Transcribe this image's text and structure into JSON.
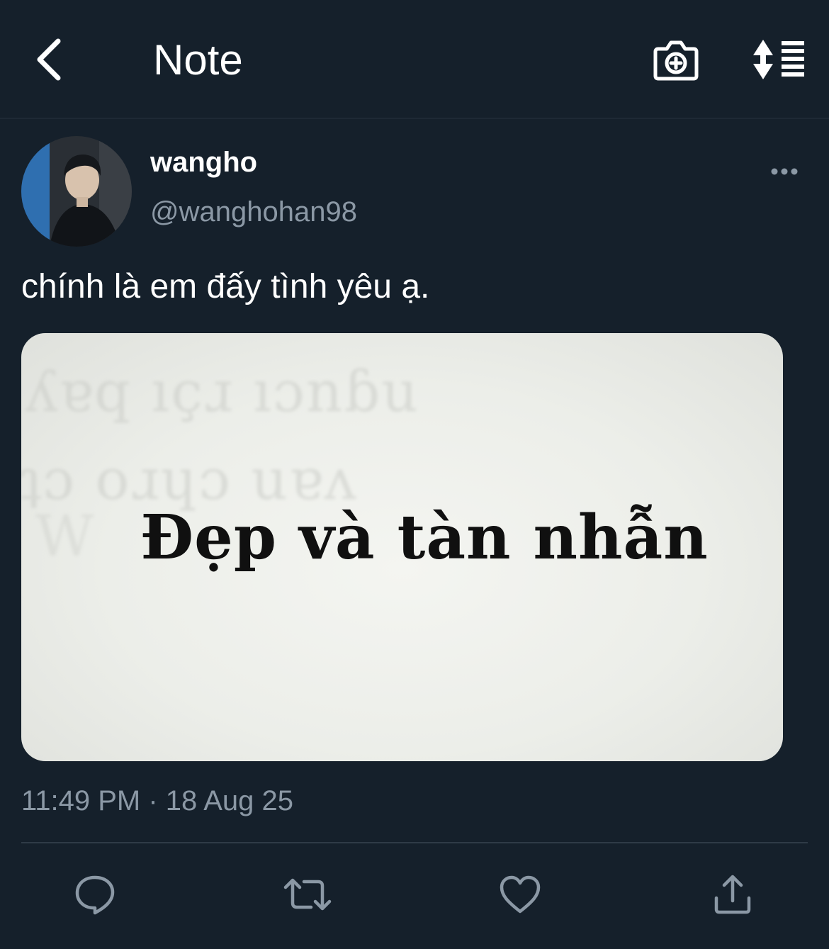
{
  "header": {
    "title": "Note",
    "back_icon": "chevron-left-icon",
    "camera_icon": "camera-plus-icon",
    "sort_icon": "sort-list-icon"
  },
  "tweet": {
    "author": {
      "display_name": "wangho",
      "handle": "@wanghohan98"
    },
    "text": "chính là em đấy tình yêu ạ.",
    "media": {
      "caption_text": "Đẹp và tàn nhẫn"
    },
    "timestamp": "11:49 PM · 18 Aug 25"
  },
  "actions": [
    {
      "name": "reply",
      "icon": "comment-icon"
    },
    {
      "name": "retweet",
      "icon": "retweet-icon"
    },
    {
      "name": "like",
      "icon": "heart-icon"
    },
    {
      "name": "share",
      "icon": "share-icon"
    }
  ],
  "colors": {
    "background": "#15202b",
    "secondary_text": "#8b98a5",
    "divider": "#2f3b47"
  }
}
